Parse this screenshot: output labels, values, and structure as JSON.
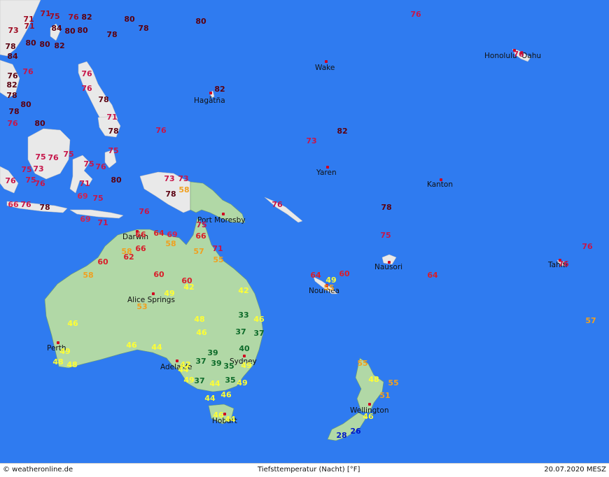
{
  "map": {
    "colors": {
      "ocean": "#2f7bf0",
      "australia_nz": "#b1d8a6",
      "other_land": "#e9e9e9"
    },
    "cities": [
      {
        "name": "Honolulu",
        "key": "honolulu"
      },
      {
        "name": "Oahu",
        "key": "oahu"
      },
      {
        "name": "Wake",
        "key": "wake"
      },
      {
        "name": "Hagåtña",
        "key": "hagatna"
      },
      {
        "name": "Yaren",
        "key": "yaren"
      },
      {
        "name": "Kanton",
        "key": "kanton"
      },
      {
        "name": "Port Moresby",
        "key": "port_moresby"
      },
      {
        "name": "Darwin",
        "key": "darwin"
      },
      {
        "name": "Nausori",
        "key": "nausori"
      },
      {
        "name": "Tahiti",
        "key": "tahiti"
      },
      {
        "name": "Nouméa",
        "key": "noumea"
      },
      {
        "name": "Alice Springs",
        "key": "alice_springs"
      },
      {
        "name": "Perth",
        "key": "perth"
      },
      {
        "name": "Adelaide",
        "key": "adelaide"
      },
      {
        "name": "Sydney",
        "key": "sydney"
      },
      {
        "name": "Wellington",
        "key": "wellington"
      },
      {
        "name": "Hobart",
        "key": "hobart"
      }
    ],
    "temperatures": [
      {
        "v": "71"
      },
      {
        "v": "71"
      },
      {
        "v": "75"
      },
      {
        "v": "76"
      },
      {
        "v": "82"
      },
      {
        "v": "80"
      },
      {
        "v": "73"
      },
      {
        "v": "71"
      },
      {
        "v": "84"
      },
      {
        "v": "80"
      },
      {
        "v": "80"
      },
      {
        "v": "78"
      },
      {
        "v": "78"
      },
      {
        "v": "80"
      },
      {
        "v": "80"
      },
      {
        "v": "82"
      },
      {
        "v": "80"
      },
      {
        "v": "78"
      },
      {
        "v": "84"
      },
      {
        "v": "76"
      },
      {
        "v": "76"
      },
      {
        "v": "82"
      },
      {
        "v": "78"
      },
      {
        "v": "76"
      },
      {
        "v": "78"
      },
      {
        "v": "80"
      },
      {
        "v": "78"
      },
      {
        "v": "76"
      },
      {
        "v": "80"
      },
      {
        "v": "71"
      },
      {
        "v": "78"
      },
      {
        "v": "76"
      },
      {
        "v": "76"
      },
      {
        "v": "75"
      },
      {
        "v": "76"
      },
      {
        "v": "75"
      },
      {
        "v": "75"
      },
      {
        "v": "73"
      },
      {
        "v": "75"
      },
      {
        "v": "76"
      },
      {
        "v": "75"
      },
      {
        "v": "75"
      },
      {
        "v": "76"
      },
      {
        "v": "76"
      },
      {
        "v": "80"
      },
      {
        "v": "71"
      },
      {
        "v": "73"
      },
      {
        "v": "69"
      },
      {
        "v": "75"
      },
      {
        "v": "66"
      },
      {
        "v": "76"
      },
      {
        "v": "78"
      },
      {
        "v": "73"
      },
      {
        "v": "58"
      },
      {
        "v": "76"
      },
      {
        "v": "69"
      },
      {
        "v": "71"
      },
      {
        "v": "78"
      },
      {
        "v": "82"
      },
      {
        "v": "76"
      },
      {
        "v": "73"
      },
      {
        "v": "82"
      },
      {
        "v": "76"
      },
      {
        "v": "78"
      },
      {
        "v": "75"
      },
      {
        "v": "75"
      },
      {
        "v": "66"
      },
      {
        "v": "64"
      },
      {
        "v": "69"
      },
      {
        "v": "66"
      },
      {
        "v": "58"
      },
      {
        "v": "71"
      },
      {
        "v": "76"
      },
      {
        "v": "66"
      },
      {
        "v": "58"
      },
      {
        "v": "62"
      },
      {
        "v": "60"
      },
      {
        "v": "57"
      },
      {
        "v": "55"
      },
      {
        "v": "58"
      },
      {
        "v": "60"
      },
      {
        "v": "60"
      },
      {
        "v": "42"
      },
      {
        "v": "49"
      },
      {
        "v": "53"
      },
      {
        "v": "42"
      },
      {
        "v": "33"
      },
      {
        "v": "46"
      },
      {
        "v": "48"
      },
      {
        "v": "46"
      },
      {
        "v": "37"
      },
      {
        "v": "37"
      },
      {
        "v": "46"
      },
      {
        "v": "46"
      },
      {
        "v": "44"
      },
      {
        "v": "40"
      },
      {
        "v": "39"
      },
      {
        "v": "37"
      },
      {
        "v": "39"
      },
      {
        "v": "35"
      },
      {
        "v": "49"
      },
      {
        "v": "48"
      },
      {
        "v": "48"
      },
      {
        "v": "42"
      },
      {
        "v": "44"
      },
      {
        "v": "49"
      },
      {
        "v": "37"
      },
      {
        "v": "35"
      },
      {
        "v": "49"
      },
      {
        "v": "49"
      },
      {
        "v": "44"
      },
      {
        "v": "46"
      },
      {
        "v": "44"
      },
      {
        "v": "46"
      },
      {
        "v": "44"
      },
      {
        "v": "64"
      },
      {
        "v": "60"
      },
      {
        "v": "49"
      },
      {
        "v": "55"
      },
      {
        "v": "64"
      },
      {
        "v": "76"
      },
      {
        "v": "76"
      },
      {
        "v": "57"
      },
      {
        "v": "55"
      },
      {
        "v": "48"
      },
      {
        "v": "55"
      },
      {
        "v": "51"
      },
      {
        "v": "46"
      },
      {
        "v": "26"
      },
      {
        "v": "28"
      }
    ]
  },
  "footer": {
    "copyright": "© weatheronline.de",
    "title": "Tiefsttemperatur (Nacht) [°F]",
    "date": "20.07.2020 MESZ"
  }
}
